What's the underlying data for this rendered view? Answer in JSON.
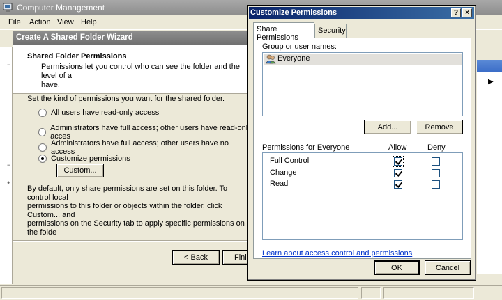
{
  "main_window": {
    "title": "Computer Management",
    "menu": [
      "File",
      "Action",
      "View",
      "Help"
    ]
  },
  "wizard": {
    "title": "Create A Shared Folder Wizard",
    "header_title": "Shared Folder Permissions",
    "header_desc": "Permissions let you control who can see the folder and the level of a\nhave.",
    "prompt": "Set the kind of permissions you want for the shared folder.",
    "options": [
      {
        "label": "All users have read-only access",
        "selected": false
      },
      {
        "label": "Administrators have full access; other users have read-only acces",
        "selected": false
      },
      {
        "label": "Administrators have full access; other users have no access",
        "selected": false
      },
      {
        "label": "Customize permissions",
        "selected": true
      }
    ],
    "custom_button": "Custom...",
    "bottom_text": "By default, only share permissions are set on this folder. To control local\npermissions to this folder or objects within the folder, click Custom... and\npermissions on the Security tab to apply specific permissions on the folde",
    "back_button": "< Back",
    "finish_button": "Finis"
  },
  "dialog": {
    "title": "Customize Permissions",
    "help_glyph": "?",
    "close_glyph": "×",
    "tabs": [
      {
        "label": "Share Permissions",
        "active": true
      },
      {
        "label": "Security",
        "active": false
      }
    ],
    "group_label": "Group or user names:",
    "groups": [
      "Everyone"
    ],
    "add_button": "Add...",
    "remove_button": "Remove",
    "permissions_label": "Permissions for Everyone",
    "allow_header": "Allow",
    "deny_header": "Deny",
    "permissions": [
      {
        "name": "Full Control",
        "allow": true,
        "deny": false
      },
      {
        "name": "Change",
        "allow": true,
        "deny": false
      },
      {
        "name": "Read",
        "allow": true,
        "deny": false
      }
    ],
    "learn_link": "Learn about access control and permissions",
    "ok_button": "OK",
    "cancel_button": "Cancel"
  }
}
